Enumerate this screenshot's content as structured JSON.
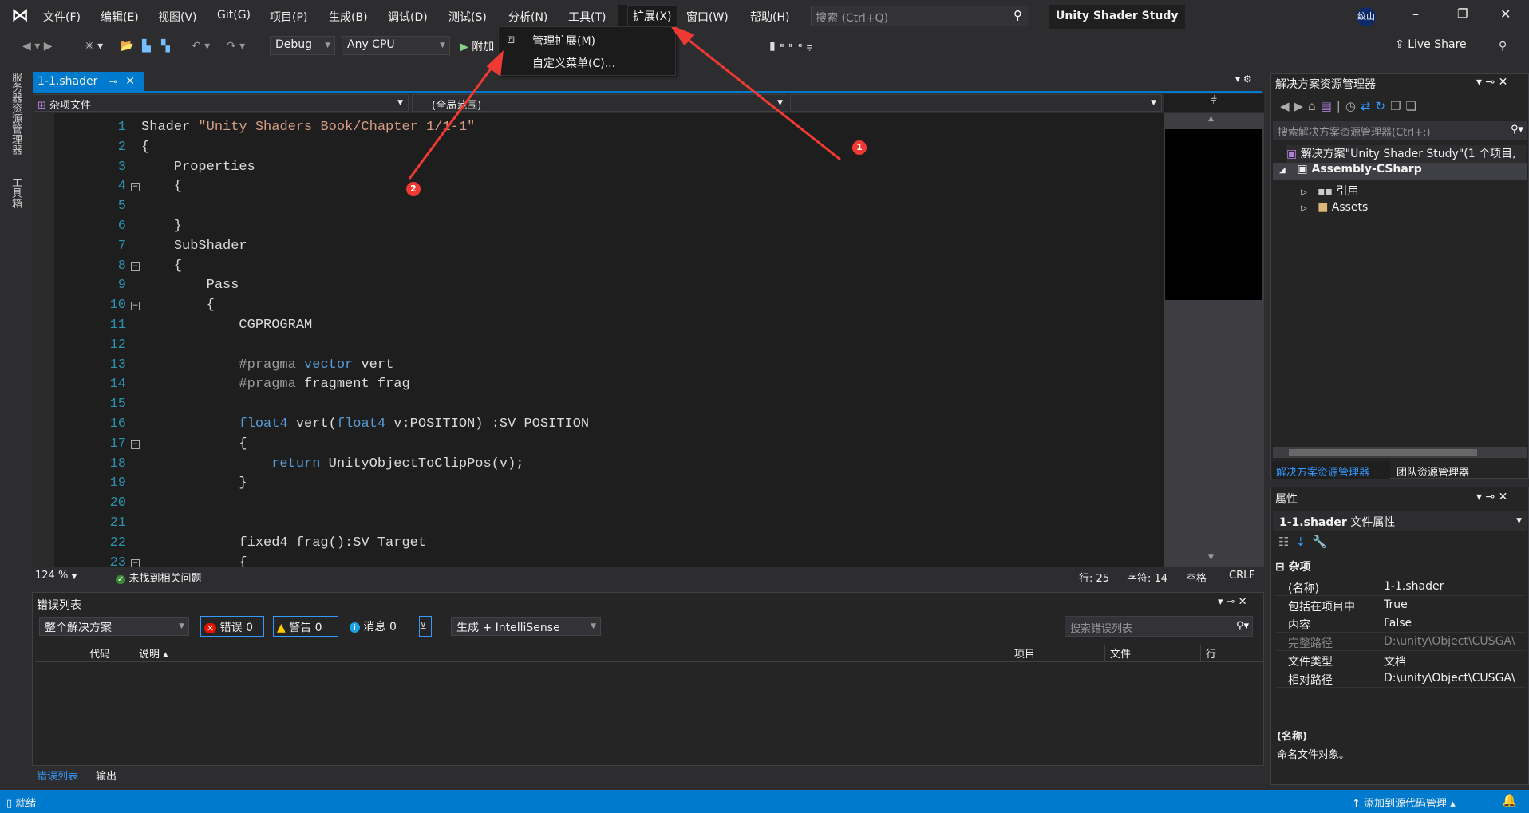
{
  "menubar": {
    "items": [
      "文件(F)",
      "编辑(E)",
      "视图(V)",
      "Git(G)",
      "项目(P)",
      "生成(B)",
      "调试(D)",
      "测试(S)",
      "分析(N)",
      "工具(T)",
      "扩展(X)",
      "窗口(W)",
      "帮助(H)"
    ],
    "search_placeholder": "搜索 (Ctrl+Q)",
    "solution_title": "Unity Shader Study",
    "avatar": "纹山"
  },
  "toolbar": {
    "config": "Debug",
    "platform": "Any CPU",
    "attach": "附加",
    "live_share": "Live Share"
  },
  "extensions_menu": {
    "items": [
      "管理扩展(M)",
      "自定义菜单(C)..."
    ]
  },
  "annotations": {
    "badge1": "1",
    "badge2": "2",
    "color": "#e53935"
  },
  "left_strip": {
    "items": [
      "服务器资源管理器",
      "工具箱"
    ]
  },
  "editor": {
    "tab": "1-1.shader",
    "nav_left": "杂项文件",
    "nav_mid": "(全局范围)",
    "zoom": "124 %",
    "issues": "未找到相关问题",
    "line": "行: 25",
    "char": "字符: 14",
    "spaces": "空格",
    "eol": "CRLF",
    "lines": [
      [
        [
          "Shader ",
          ""
        ],
        [
          "\"Unity Shaders Book/Chapter 1/1-1\"",
          "str"
        ]
      ],
      [
        [
          "{",
          ""
        ]
      ],
      [
        [
          "    Properties",
          ""
        ]
      ],
      [
        [
          "    {",
          ""
        ]
      ],
      [
        [
          "",
          ""
        ]
      ],
      [
        [
          "    }",
          ""
        ]
      ],
      [
        [
          "    SubShader",
          ""
        ]
      ],
      [
        [
          "    {",
          ""
        ]
      ],
      [
        [
          "        Pass",
          ""
        ]
      ],
      [
        [
          "        {",
          ""
        ]
      ],
      [
        [
          "            CGPROGRAM",
          ""
        ]
      ],
      [
        [
          "",
          ""
        ]
      ],
      [
        [
          "            #pragma ",
          "pp"
        ],
        [
          "vector",
          "kw"
        ],
        [
          " vert",
          ""
        ]
      ],
      [
        [
          "            #pragma ",
          "pp"
        ],
        [
          "fragment frag",
          ""
        ]
      ],
      [
        [
          "",
          ""
        ]
      ],
      [
        [
          "            ",
          ""
        ],
        [
          "float4",
          "kw"
        ],
        [
          " vert(",
          ""
        ],
        [
          "float4",
          "kw"
        ],
        [
          " v:POSITION) :SV_POSITION",
          ""
        ]
      ],
      [
        [
          "            {",
          ""
        ]
      ],
      [
        [
          "                ",
          ""
        ],
        [
          "return",
          "kw"
        ],
        [
          " UnityObjectToClipPos(v);",
          ""
        ]
      ],
      [
        [
          "            }",
          ""
        ]
      ],
      [
        [
          "",
          ""
        ]
      ],
      [
        [
          "",
          ""
        ]
      ],
      [
        [
          "            fixed4 frag():SV_Target",
          ""
        ]
      ],
      [
        [
          "            {",
          ""
        ]
      ]
    ],
    "fold_lines": [
      4,
      8,
      10,
      17,
      23
    ]
  },
  "error_list": {
    "title": "错误列表",
    "scope": "整个解决方案",
    "errors": "错误 0",
    "warnings": "警告 0",
    "messages": "消息 0",
    "source": "生成 + IntelliSense",
    "search_placeholder": "搜索错误列表",
    "columns": [
      "代码",
      "说明",
      "项目",
      "文件",
      "行"
    ]
  },
  "bottom_tabs": [
    "错误列表",
    "输出"
  ],
  "solution_explorer": {
    "title": "解决方案资源管理器",
    "search_placeholder": "搜索解决方案资源管理器(Ctrl+;)",
    "solution": "解决方案\"Unity Shader Study\"(1 个项目,",
    "project": "Assembly-CSharp",
    "references": "引用",
    "assets": "Assets",
    "tabs": [
      "解决方案资源管理器",
      "团队资源管理器"
    ]
  },
  "properties": {
    "title": "属性",
    "object": "1-1.shader",
    "object_type": "文件属性",
    "category": "杂项",
    "rows": [
      [
        "(名称)",
        "1-1.shader"
      ],
      [
        "包括在项目中",
        "True"
      ],
      [
        "内容",
        "False"
      ],
      [
        "完整路径",
        "D:\\unity\\Object\\CUSGA\\"
      ],
      [
        "文件类型",
        "文档"
      ],
      [
        "相对路径",
        "D:\\unity\\Object\\CUSGA\\"
      ]
    ],
    "desc_title": "(名称)",
    "desc_text": "命名文件对象。"
  },
  "statusbar": {
    "ready": "就绪",
    "source_control": "添加到源代码管理",
    "color": "#007acc"
  }
}
